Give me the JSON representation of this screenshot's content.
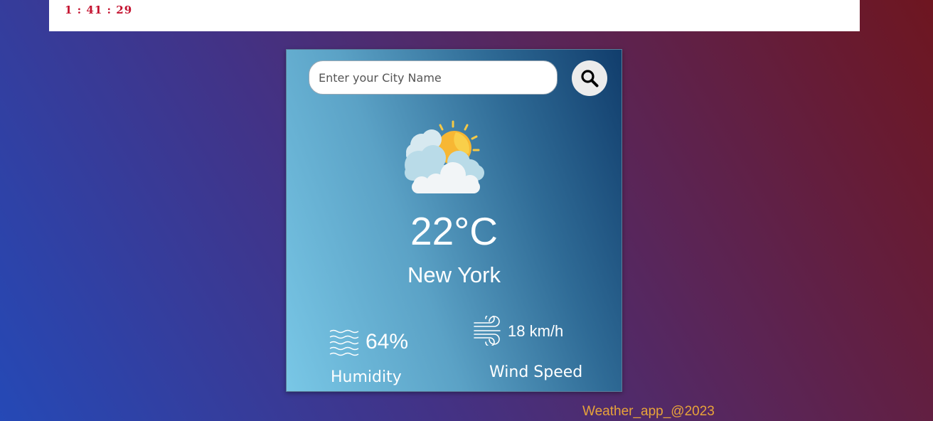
{
  "header": {
    "clock": "1 : 41 : 29"
  },
  "search": {
    "placeholder": "Enter your City Name",
    "icon": "search-icon"
  },
  "weather": {
    "icon": "partly-cloudy-icon",
    "temperature": "22°C",
    "city": "New York",
    "humidity": {
      "icon": "humidity-waves-icon",
      "value": "64%",
      "label": "Humidity"
    },
    "wind": {
      "icon": "wind-icon",
      "value": "18 km/h",
      "label": "Wind Speed"
    }
  },
  "footer": {
    "text": "Weather_app_@2023"
  },
  "colors": {
    "clock": "#c4122f",
    "footer": "#e8a33a",
    "card_gradient_start": "#79c7e6",
    "card_gradient_end": "#113d6c"
  }
}
